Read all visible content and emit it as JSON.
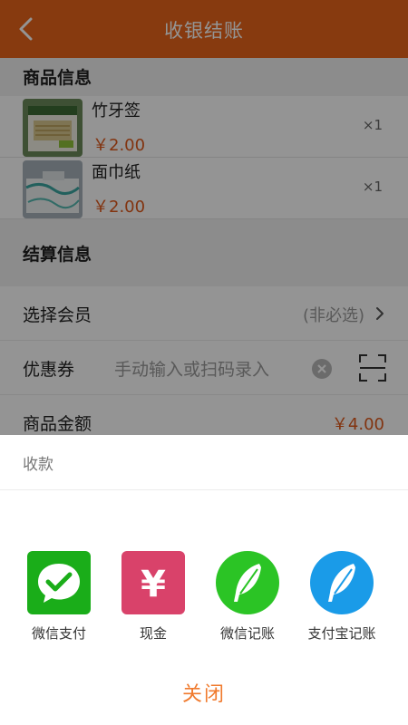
{
  "header": {
    "title": "收银结账"
  },
  "sections": {
    "products_title": "商品信息",
    "settlement_title": "结算信息"
  },
  "products": [
    {
      "name": "竹牙签",
      "price": "￥2.00",
      "qty": "×1"
    },
    {
      "name": "面巾纸",
      "price": "￥2.00",
      "qty": "×1"
    }
  ],
  "settlement": {
    "member_label": "选择会员",
    "member_hint": "(非必选)",
    "coupon_label": "优惠券",
    "coupon_placeholder": "手动输入或扫码录入",
    "amount_label": "商品金额",
    "amount_value": "￥4.00"
  },
  "sheet": {
    "title": "收款",
    "methods": [
      {
        "label": "微信支付",
        "color": "#1aad19"
      },
      {
        "label": "现金",
        "color": "#d9426a"
      },
      {
        "label": "微信记账",
        "color": "#2bc425"
      },
      {
        "label": "支付宝记账",
        "color": "#1a9be8"
      }
    ],
    "close_label": "关闭"
  }
}
